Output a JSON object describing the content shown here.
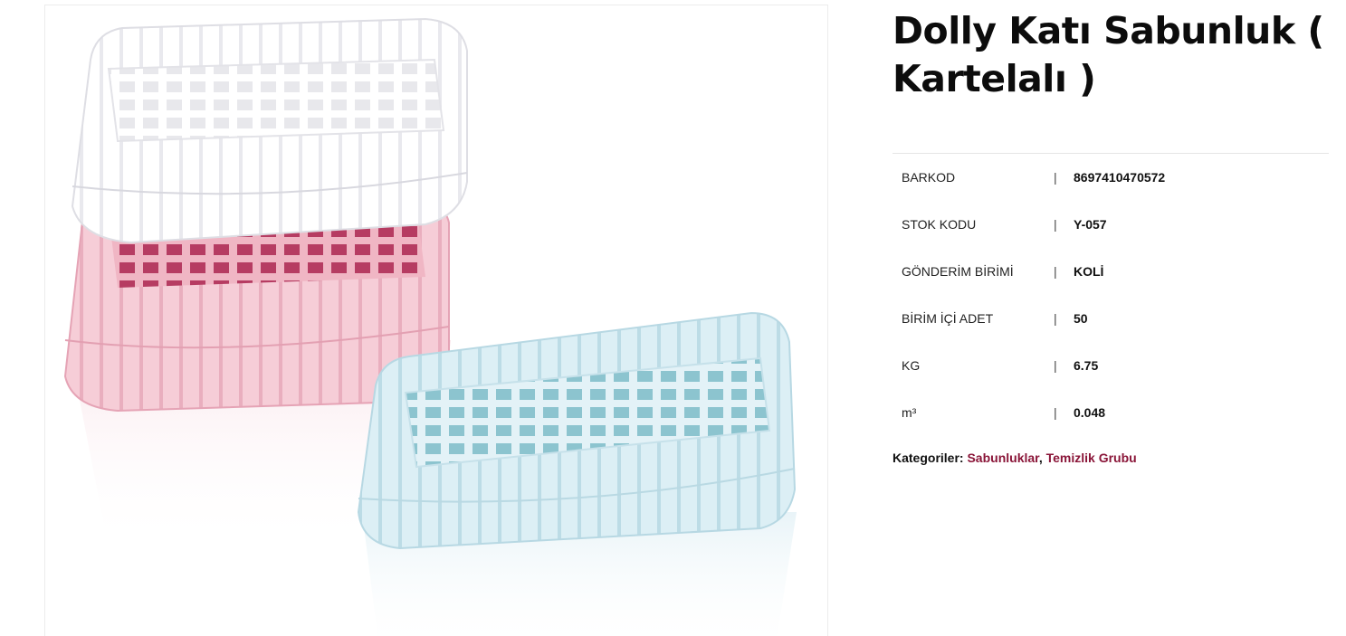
{
  "product": {
    "title": "Dolly Katı Sabunluk ( Kartelalı )",
    "image": {
      "description_colors": {
        "white_dish": "#ffffff",
        "pink_dish": "#f3c7d2",
        "blue_dish": "#d6ecf3"
      }
    },
    "attributes": [
      {
        "label": "BARKOD",
        "separator": "|",
        "value": "8697410470572"
      },
      {
        "label": "STOK KODU",
        "separator": "|",
        "value": "Y-057"
      },
      {
        "label": "GÖNDERİM BİRİMİ",
        "separator": "|",
        "value": "KOLİ"
      },
      {
        "label": "BİRİM İÇİ ADET",
        "separator": "|",
        "value": "50"
      },
      {
        "label": "KG",
        "separator": "|",
        "value": "6.75"
      },
      {
        "label": "m³",
        "separator": "|",
        "value": "0.048"
      }
    ],
    "categories": {
      "label": "Kategoriler:",
      "items": [
        "Sabunluklar",
        "Temizlik Grubu"
      ],
      "separator": ","
    }
  },
  "colors": {
    "link": "#8a1538",
    "title": "#0c0c0c"
  }
}
